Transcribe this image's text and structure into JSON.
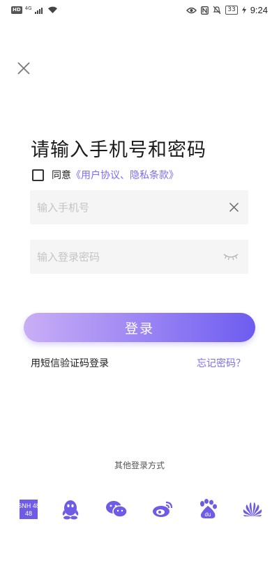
{
  "status_bar": {
    "network_badge": "HD",
    "signal_type": "4G",
    "battery": "33",
    "time": "9:24",
    "icons": [
      "signal-icon",
      "wifi-icon",
      "eye-icon",
      "nfc-icon",
      "mute-icon",
      "charging-icon"
    ]
  },
  "header": {
    "close_icon": "close-icon"
  },
  "title": "请输入手机号和密码",
  "agreement": {
    "prefix": "同意",
    "link": "《用户协议、隐私条款》",
    "checked": false
  },
  "phone_field": {
    "placeholder": "输入手机号",
    "value": ""
  },
  "password_field": {
    "placeholder": "输入登录密码",
    "value": ""
  },
  "login_button": "登录",
  "sms_login": "用短信验证码登录",
  "forgot_password": "忘记密码？",
  "other_login": {
    "label": "其他登录方式",
    "providers": [
      {
        "name": "SNH48",
        "icon": "snh48-icon",
        "text": "SNH 48"
      },
      {
        "name": "QQ",
        "icon": "qq-icon"
      },
      {
        "name": "WeChat",
        "icon": "wechat-icon"
      },
      {
        "name": "Weibo",
        "icon": "weibo-icon"
      },
      {
        "name": "Baidu",
        "icon": "baidu-icon",
        "text": "du"
      },
      {
        "name": "Huawei",
        "icon": "huawei-icon"
      }
    ]
  },
  "colors": {
    "accent": "#7c6cf0",
    "button_gradient_start": "#c9aef5",
    "button_gradient_end": "#6d5cf0",
    "icon_purple": "#6e5ce6"
  }
}
